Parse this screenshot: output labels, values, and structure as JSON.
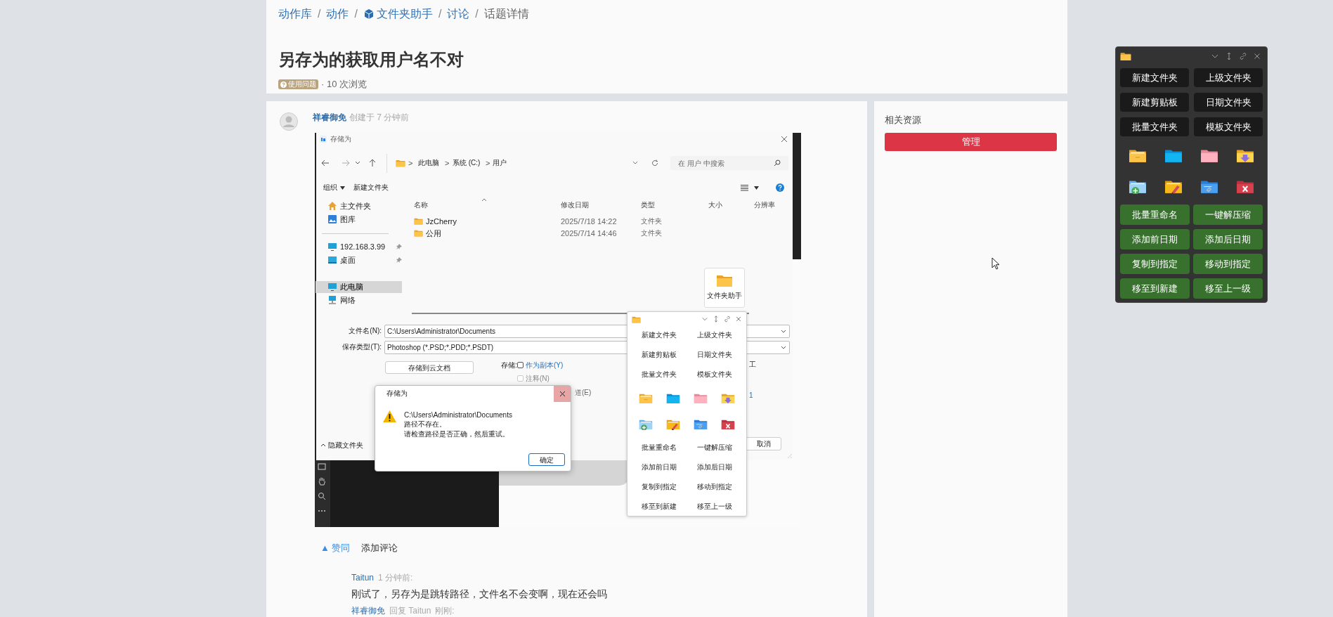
{
  "breadcrumb": {
    "items": [
      {
        "label": "动作库",
        "kind": "link"
      },
      {
        "label": "动作",
        "kind": "link"
      },
      {
        "label": "文件夹助手",
        "kind": "link_cube"
      },
      {
        "label": "讨论",
        "kind": "link"
      },
      {
        "label": "话题详情",
        "kind": "current"
      }
    ],
    "separators": [
      "/",
      "/",
      "/",
      "/"
    ]
  },
  "topic": {
    "title": "另存为的获取用户名不对",
    "tag": "使用问题",
    "views": "· 10 次浏览"
  },
  "post": {
    "author": "祥睿御免",
    "created": "创建于 7 分钟前",
    "screenshot": {
      "dialog": {
        "title": "存储为",
        "path": [
          "此电脑",
          "系统 (C:)",
          "用户"
        ],
        "path_separators": [
          ">",
          ">",
          ">"
        ],
        "search": "在 用户 中搜索",
        "organize": "组织",
        "new_folder": "新建文件夹",
        "columns": [
          "名称",
          "修改日期",
          "类型",
          "大小",
          "分辨率"
        ],
        "files": [
          {
            "name": "JzCherry",
            "modified": "2025/7/18 14:22",
            "type": "文件夹"
          },
          {
            "name": "公用",
            "modified": "2025/7/14 14:46",
            "type": "文件夹"
          }
        ],
        "nav_groups": [
          [
            {
              "label": "主文件夹",
              "kind": "home",
              "selected": false,
              "pinned": false
            },
            {
              "label": "图库",
              "kind": "gallery",
              "selected": false,
              "pinned": false
            }
          ],
          [
            {
              "label": "192.168.3.99",
              "kind": "monitor",
              "selected": false,
              "pinned": true
            },
            {
              "label": "桌面",
              "kind": "desktop",
              "selected": false,
              "pinned": true
            }
          ],
          [
            {
              "label": "此电脑",
              "kind": "monitor",
              "selected": true,
              "pinned": false
            },
            {
              "label": "网络",
              "kind": "network",
              "selected": false,
              "pinned": false
            }
          ]
        ],
        "file_name_label": "文件名(N):",
        "file_name": "C:\\Users\\Administrator\\Documents",
        "type_label": "保存类型(T):",
        "type_value": "Photoshop (*.PSD;*.PDD;*.PSDT)",
        "cloud_button": "存储到云文档",
        "save_label": "存储:",
        "options": [
          {
            "label": "作为副本(Y)",
            "checked": false,
            "disabled": false
          },
          {
            "label": "注释(N)",
            "checked": false,
            "disabled": true
          }
        ],
        "partial_option": "道(E)",
        "fragment_right": "工",
        "fragment_number": "1",
        "cancel": "取消",
        "hide_folders": "隐藏文件夹"
      },
      "helper_tile": "文件夹助手",
      "alert": {
        "title": "存储为",
        "lines": [
          "C:\\Users\\Administrator\\Documents",
          "路径不存在。",
          "请检查路径是否正确，然后重试。"
        ],
        "ok": "确定"
      },
      "mini_panel": {
        "top_buttons": [
          "新建文件夹",
          "上级文件夹",
          "新建剪贴板",
          "日期文件夹",
          "批量文件夹",
          "模板文件夹"
        ],
        "bottom_buttons": [
          "批量重命名",
          "一键解压缩",
          "添加前日期",
          "添加后日期",
          "复制到指定",
          "移动到指定",
          "移至到新建",
          "移至上一级"
        ]
      }
    },
    "actions": {
      "upvote": "▲ 赞同",
      "comment": "添加评论"
    }
  },
  "comments": [
    {
      "author": "Taitun",
      "time": "1 分钟前:",
      "text": "刚试了，另存为是跳转路径，文件名不会变啊，现在还会吗"
    },
    {
      "author": "祥睿御免",
      "reply": "回复 Taitun",
      "time": "刚刚:"
    }
  ],
  "sidebar": {
    "heading": "相关资源",
    "button": "管理"
  },
  "panel": {
    "top_buttons": [
      "新建文件夹",
      "上级文件夹",
      "新建剪贴板",
      "日期文件夹",
      "批量文件夹",
      "模板文件夹"
    ],
    "bottom_buttons": [
      "批量重命名",
      "一键解压缩",
      "添加前日期",
      "添加后日期",
      "复制到指定",
      "移动到指定",
      "移至到新建",
      "移至上一级"
    ]
  }
}
